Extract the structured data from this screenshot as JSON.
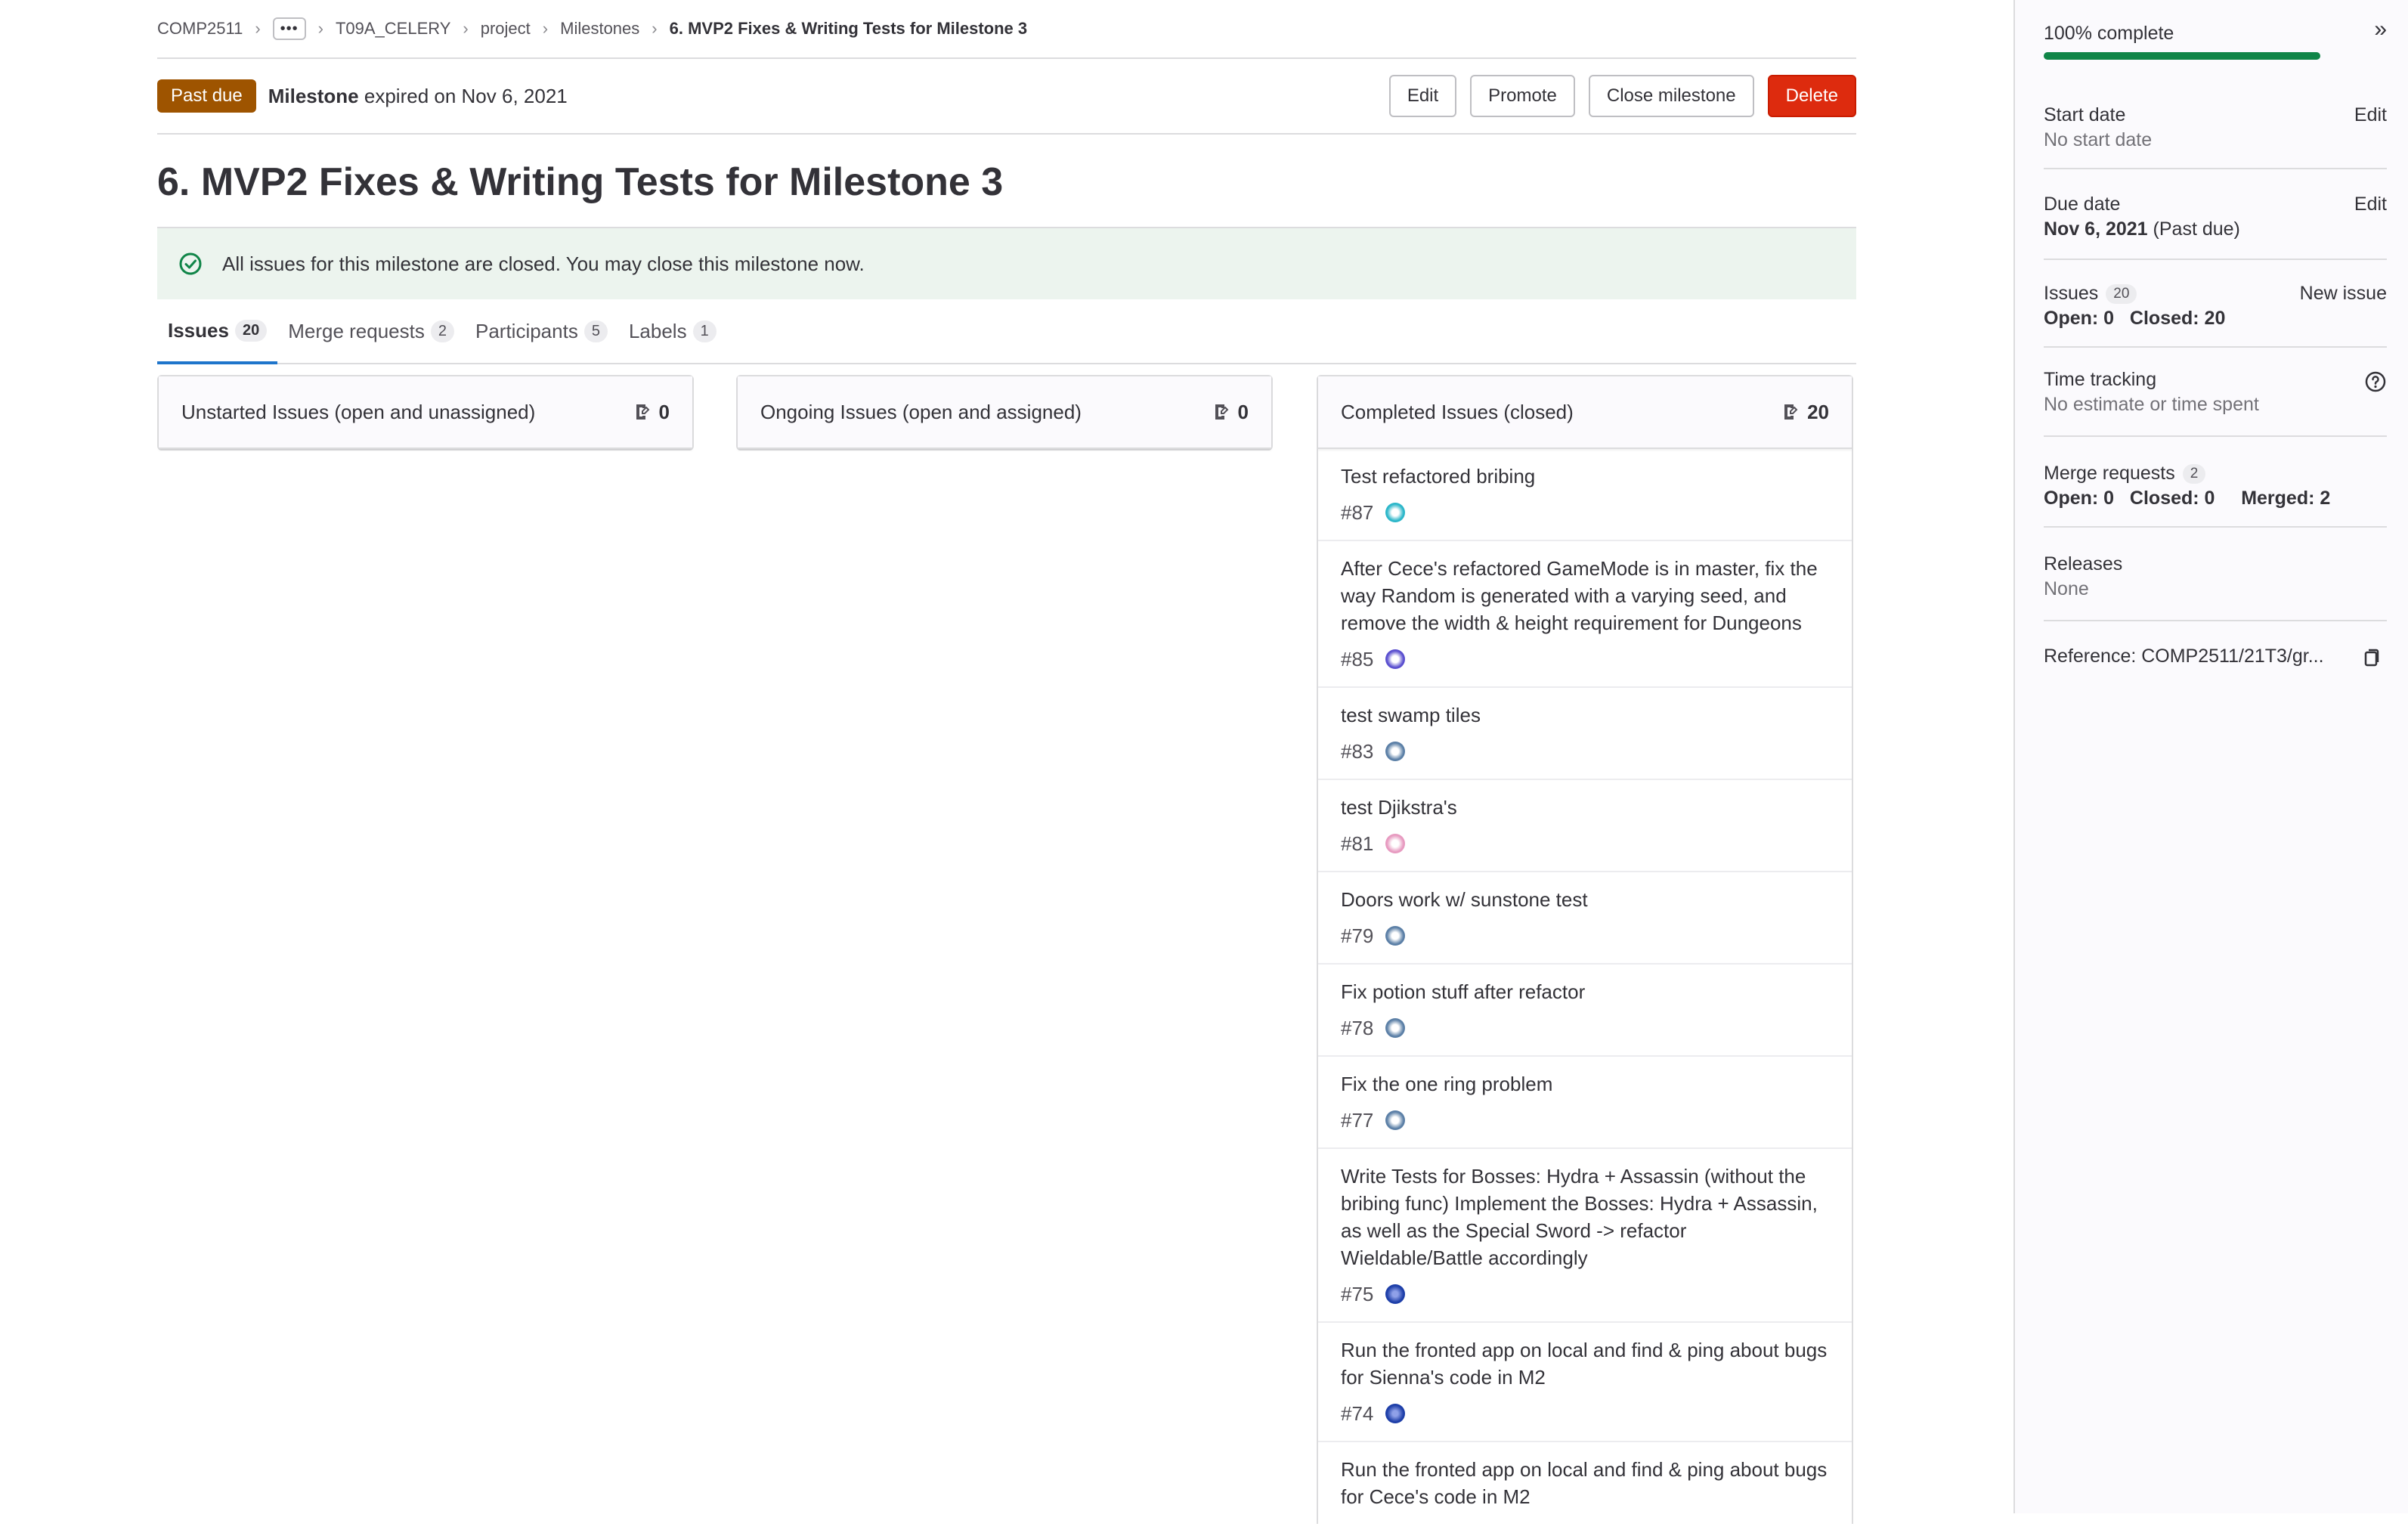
{
  "breadcrumb": {
    "items": [
      "COMP2511",
      "T09A_CELERY",
      "project",
      "Milestones"
    ],
    "current": "6. MVP2 Fixes & Writing Tests for Milestone 3",
    "ellipsis": "•••"
  },
  "header": {
    "badge": "Past due",
    "label": "Milestone",
    "text": "expired on Nov 6, 2021",
    "buttons": {
      "edit": "Edit",
      "promote": "Promote",
      "close": "Close milestone",
      "delete": "Delete"
    }
  },
  "title": "6. MVP2 Fixes & Writing Tests for Milestone 3",
  "alert": "All issues for this milestone are closed. You may close this milestone now.",
  "tabs": [
    {
      "label": "Issues",
      "count": "20"
    },
    {
      "label": "Merge requests",
      "count": "2"
    },
    {
      "label": "Participants",
      "count": "5"
    },
    {
      "label": "Labels",
      "count": "1"
    }
  ],
  "columns": {
    "unstarted": {
      "title": "Unstarted Issues (open and unassigned)",
      "count": "0"
    },
    "ongoing": {
      "title": "Ongoing Issues (open and assigned)",
      "count": "0"
    },
    "completed": {
      "title": "Completed Issues (closed)",
      "count": "20",
      "issues": [
        {
          "title": "Test refactored bribing",
          "ref": "#87",
          "avatar_color": "#2bb6c9"
        },
        {
          "title": "After Cece's refactored GameMode is in master, fix the way Random is generated with a varying seed, and remove the width & height requirement for Dungeons",
          "ref": "#85",
          "avatar_color": "#5a4fcf"
        },
        {
          "title": "test swamp tiles",
          "ref": "#83",
          "avatar_color": "#5b7fa6"
        },
        {
          "title": "test Djikstra's",
          "ref": "#81",
          "avatar_color": "#e79ac0"
        },
        {
          "title": "Doors work w/ sunstone test",
          "ref": "#79",
          "avatar_color": "#5b7fa6"
        },
        {
          "title": "Fix potion stuff after refactor",
          "ref": "#78",
          "avatar_color": "#5b7fa6"
        },
        {
          "title": "Fix the one ring problem",
          "ref": "#77",
          "avatar_color": "#5b7fa6"
        },
        {
          "title": "Write Tests for Bosses: Hydra + Assassin (without the bribing func) Implement the Bosses: Hydra + Assassin, as well as the Special Sword -> refactor Wieldable/Battle accordingly",
          "ref": "#75",
          "avatar_color": "#1d3ea8"
        },
        {
          "title": "Run the fronted app on local and find & ping about bugs for Sienna's code in M2",
          "ref": "#74",
          "avatar_color": "#1d3ea8"
        },
        {
          "title": "Run the fronted app on local and find & ping about bugs for Cece's code in M2",
          "ref": "",
          "avatar_color": "#1d3ea8"
        }
      ]
    }
  },
  "sidebar": {
    "progress_label": "100% complete",
    "progress_fraction": 1.0,
    "start": {
      "label": "Start date",
      "value": "No start date",
      "edit": "Edit"
    },
    "due": {
      "label": "Due date",
      "value": "Nov 6, 2021",
      "suffix": "(Past due)",
      "edit": "Edit"
    },
    "issues": {
      "label": "Issues",
      "count": "20",
      "open": "Open: 0",
      "closed": "Closed: 20",
      "action": "New issue"
    },
    "time": {
      "label": "Time tracking",
      "value": "No estimate or time spent"
    },
    "mrs": {
      "label": "Merge requests",
      "count": "2",
      "open": "Open: 0",
      "closed": "Closed: 0",
      "merged": "Merged: 2"
    },
    "releases": {
      "label": "Releases",
      "value": "None"
    },
    "reference": "Reference: COMP2511/21T3/gr..."
  },
  "colors": {
    "accent": "#1f75cb",
    "danger": "#dd2b0e",
    "pastdue": "#9e5400",
    "success": "#108548"
  }
}
